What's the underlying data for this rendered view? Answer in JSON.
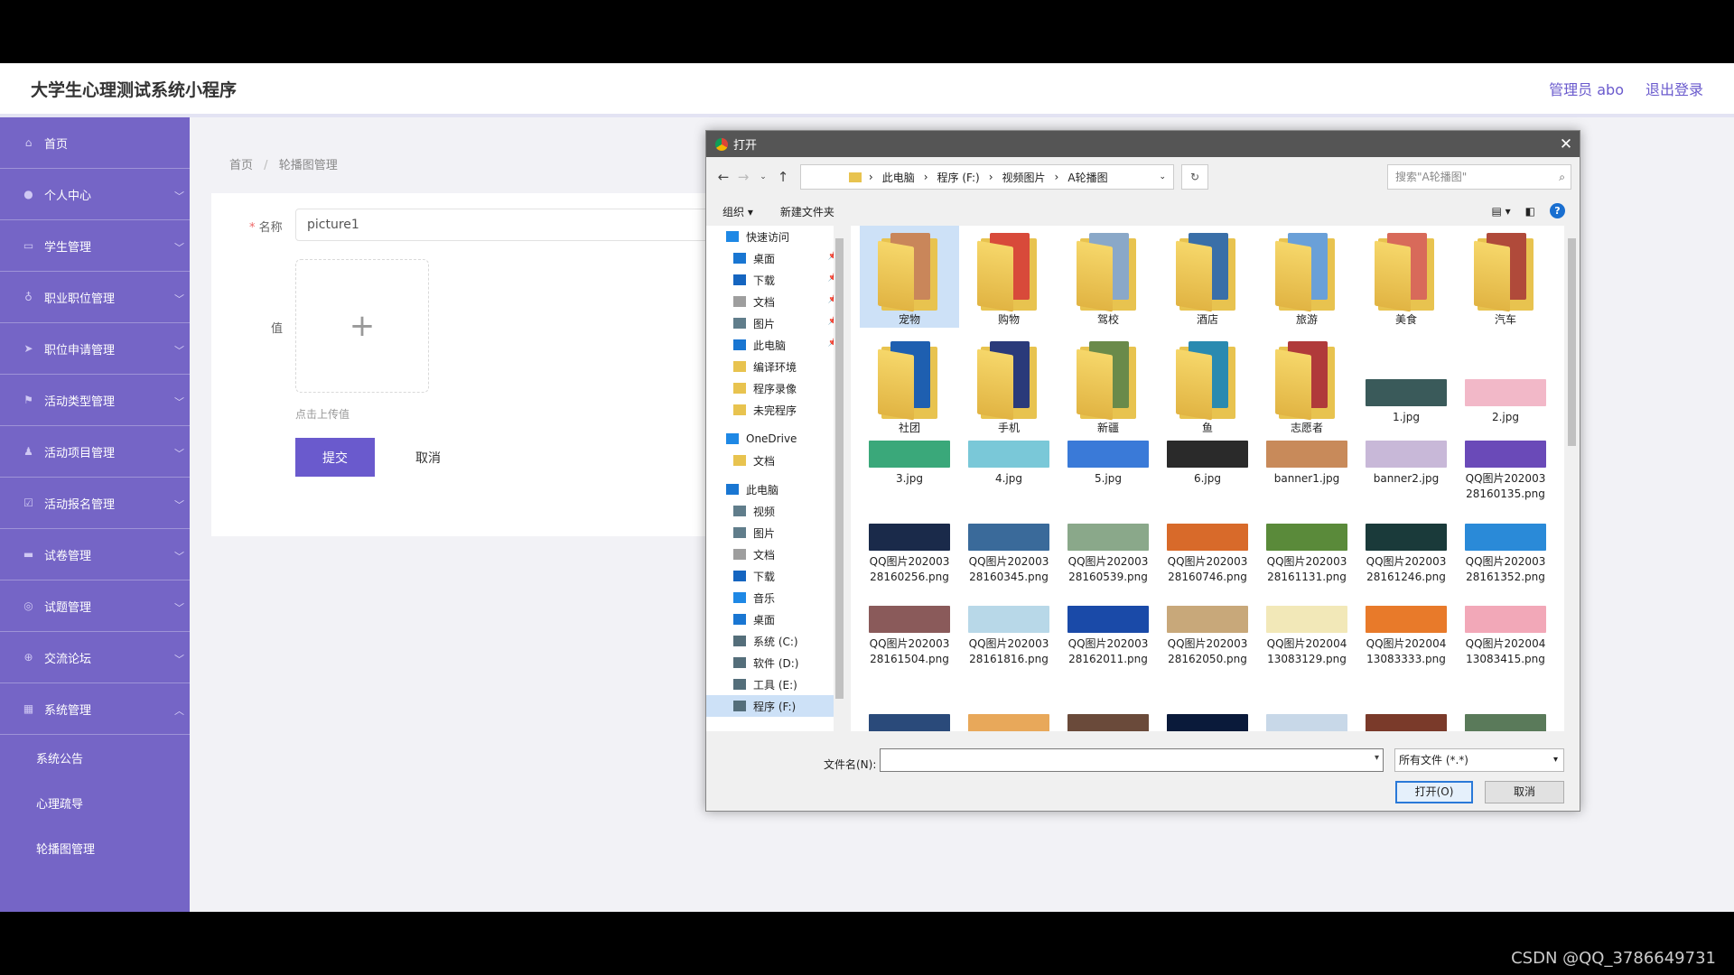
{
  "header": {
    "title": "大学生心理测试系统小程序",
    "admin": "管理员 abo",
    "logout": "退出登录"
  },
  "sidebar": {
    "items": [
      {
        "label": "首页",
        "icon": "home-icon",
        "chevron": false
      },
      {
        "label": "个人中心",
        "icon": "user-icon",
        "chevron": true
      },
      {
        "label": "学生管理",
        "icon": "chat-icon",
        "chevron": true
      },
      {
        "label": "职业职位管理",
        "icon": "mic-icon",
        "chevron": true
      },
      {
        "label": "职位申请管理",
        "icon": "send-icon",
        "chevron": true
      },
      {
        "label": "活动类型管理",
        "icon": "flag-icon",
        "chevron": true
      },
      {
        "label": "活动项目管理",
        "icon": "person-icon",
        "chevron": true
      },
      {
        "label": "活动报名管理",
        "icon": "check-icon",
        "chevron": true
      },
      {
        "label": "试卷管理",
        "icon": "doc-icon",
        "chevron": true
      },
      {
        "label": "试题管理",
        "icon": "circle-icon",
        "chevron": true
      },
      {
        "label": "交流论坛",
        "icon": "compass-icon",
        "chevron": true
      },
      {
        "label": "系统管理",
        "icon": "grid-icon",
        "chevron": true
      }
    ],
    "sub_items": [
      "系统公告",
      "心理疏导",
      "轮播图管理"
    ]
  },
  "breadcrumb": {
    "home": "首页",
    "sep": "/",
    "current": "轮播图管理"
  },
  "form": {
    "name_label": "名称",
    "required_mark": "*",
    "name_value": "picture1",
    "value_label": "值",
    "plus": "+",
    "upload_hint": "点击上传值",
    "submit": "提交",
    "cancel": "取消"
  },
  "dialog": {
    "title": "打开",
    "close": "✕",
    "path": [
      "此电脑",
      "程序 (F:)",
      "视频图片",
      "A轮播图"
    ],
    "search_placeholder": "搜索\"A轮播图\"",
    "organize": "组织 ▾",
    "new_folder": "新建文件夹",
    "help": "?",
    "nav": [
      {
        "label": "快速访问",
        "level": 0,
        "pin": false,
        "color": "#1e88e5"
      },
      {
        "label": "桌面",
        "level": 1,
        "pin": true,
        "color": "#1976d2"
      },
      {
        "label": "下载",
        "level": 1,
        "pin": true,
        "color": "#1565c0"
      },
      {
        "label": "文档",
        "level": 1,
        "pin": true,
        "color": "#9e9e9e"
      },
      {
        "label": "图片",
        "level": 1,
        "pin": true,
        "color": "#607d8b"
      },
      {
        "label": "此电脑",
        "level": 1,
        "pin": true,
        "color": "#1976d2"
      },
      {
        "label": "编译环境",
        "level": 1,
        "pin": false,
        "color": "#e8c34f"
      },
      {
        "label": "程序录像",
        "level": 1,
        "pin": false,
        "color": "#e8c34f"
      },
      {
        "label": "未完程序",
        "level": 1,
        "pin": false,
        "color": "#e8c34f"
      },
      {
        "label": "OneDrive",
        "level": 0,
        "pin": false,
        "color": "#1e88e5"
      },
      {
        "label": "文档",
        "level": 1,
        "pin": false,
        "color": "#e8c34f"
      },
      {
        "label": "此电脑",
        "level": 0,
        "pin": false,
        "color": "#1976d2"
      },
      {
        "label": "视频",
        "level": 1,
        "pin": false,
        "color": "#607d8b"
      },
      {
        "label": "图片",
        "level": 1,
        "pin": false,
        "color": "#607d8b"
      },
      {
        "label": "文档",
        "level": 1,
        "pin": false,
        "color": "#9e9e9e"
      },
      {
        "label": "下载",
        "level": 1,
        "pin": false,
        "color": "#1565c0"
      },
      {
        "label": "音乐",
        "level": 1,
        "pin": false,
        "color": "#1e88e5"
      },
      {
        "label": "桌面",
        "level": 1,
        "pin": false,
        "color": "#1976d2"
      },
      {
        "label": "系统 (C:)",
        "level": 1,
        "pin": false,
        "color": "#546e7a"
      },
      {
        "label": "软件 (D:)",
        "level": 1,
        "pin": false,
        "color": "#546e7a"
      },
      {
        "label": "工具 (E:)",
        "level": 1,
        "pin": false,
        "color": "#546e7a"
      },
      {
        "label": "程序 (F:)",
        "level": 1,
        "pin": false,
        "color": "#546e7a",
        "selected": true
      }
    ],
    "folders": [
      {
        "name": "宠物",
        "color": "#c9865a"
      },
      {
        "name": "购物",
        "color": "#d84a3a"
      },
      {
        "name": "驾校",
        "color": "#8aa8c8"
      },
      {
        "name": "酒店",
        "color": "#3a6fa8"
      },
      {
        "name": "旅游",
        "color": "#6aa0d8"
      },
      {
        "name": "美食",
        "color": "#d86a5a"
      },
      {
        "name": "汽车",
        "color": "#b04a3a"
      },
      {
        "name": "社团",
        "color": "#1e5fb0"
      },
      {
        "name": "手机",
        "color": "#2a3a7a"
      },
      {
        "name": "新疆",
        "color": "#6a8a4a"
      },
      {
        "name": "鱼",
        "color": "#2a8ab0"
      },
      {
        "name": "志愿者",
        "color": "#b03a3a"
      }
    ],
    "files": [
      {
        "name": "1.jpg",
        "color": "#3a5a5a"
      },
      {
        "name": "2.jpg",
        "color": "#f2b8c8"
      },
      {
        "name": "3.jpg",
        "color": "#3aa87a"
      },
      {
        "name": "4.jpg",
        "color": "#7ac8d8"
      },
      {
        "name": "5.jpg",
        "color": "#3a7ad8"
      },
      {
        "name": "6.jpg",
        "color": "#2a2a2a"
      },
      {
        "name": "banner1.jpg",
        "color": "#c88a5a"
      },
      {
        "name": "banner2.jpg",
        "color": "#c8b8d8"
      },
      {
        "name": "QQ图片20200328160135.png",
        "color": "#6a4ab8"
      },
      {
        "name": "QQ图片20200328160256.png",
        "color": "#1a2a4a"
      },
      {
        "name": "QQ图片20200328160345.png",
        "color": "#3a6a9a"
      },
      {
        "name": "QQ图片20200328160539.png",
        "color": "#8aa88a"
      },
      {
        "name": "QQ图片20200328160746.png",
        "color": "#d86a2a"
      },
      {
        "name": "QQ图片20200328161131.png",
        "color": "#5a8a3a"
      },
      {
        "name": "QQ图片20200328161246.png",
        "color": "#1a3a3a"
      },
      {
        "name": "QQ图片20200328161352.png",
        "color": "#2a8ad8"
      },
      {
        "name": "QQ图片20200328161504.png",
        "color": "#8a5a5a"
      },
      {
        "name": "QQ图片20200328161816.png",
        "color": "#b8d8e8"
      },
      {
        "name": "QQ图片20200328162011.png",
        "color": "#1a4aa8"
      },
      {
        "name": "QQ图片20200328162050.png",
        "color": "#c8a87a"
      },
      {
        "name": "QQ图片20200413083129.png",
        "color": "#f2e8b8"
      },
      {
        "name": "QQ图片20200413083333.png",
        "color": "#e87a2a"
      },
      {
        "name": "QQ图片20200413083415.png",
        "color": "#f2a8b8"
      }
    ],
    "partial_row": [
      "#2a4a7a",
      "#e8a85a",
      "#6a4a3a",
      "#0a1a3a",
      "#c8d8e8",
      "#7a3a2a",
      "#5a7a5a"
    ],
    "filename_label": "文件名(N):",
    "filename_value": "",
    "filetype": "所有文件 (*.*)",
    "open": "打开(O)",
    "cancel": "取消"
  },
  "watermark": "CSDN @QQ_3786649731"
}
